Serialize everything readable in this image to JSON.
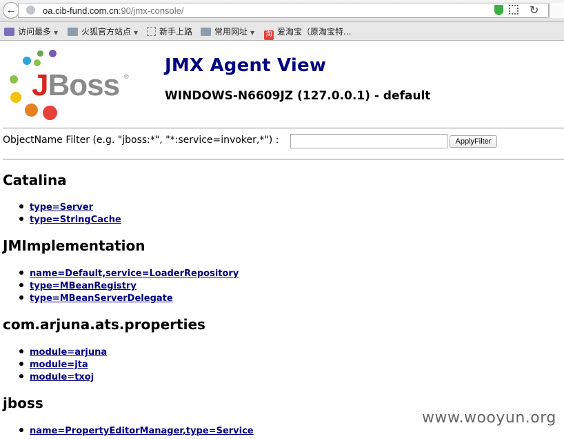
{
  "browser": {
    "url_host": "oa.cib-fund.com.cn",
    "url_rest": ":90/jmx-console/",
    "bookmarks": [
      {
        "label": "访问最多",
        "icon": "smart-folder-icon",
        "has_dropdown": true
      },
      {
        "label": "火狐官方站点",
        "icon": "folder-icon",
        "has_dropdown": true
      },
      {
        "label": "新手上路",
        "icon": "blank-page-icon",
        "has_dropdown": false
      },
      {
        "label": "常用网址",
        "icon": "folder-icon",
        "has_dropdown": true
      },
      {
        "label": "爱淘宝（原淘宝特...",
        "icon": "taobao-icon",
        "has_dropdown": false
      }
    ]
  },
  "header": {
    "logo_j": "J",
    "logo_rest": "Boss",
    "logo_reg": "®",
    "title": "JMX Agent View",
    "subtitle": "WINDOWS-N6609JZ (127.0.0.1) - default"
  },
  "filter": {
    "label": "ObjectName Filter (e.g. \"jboss:*\", \"*:service=invoker,*\") :",
    "value": "",
    "button_label": "ApplyFilter"
  },
  "domains": [
    {
      "name": "Catalina",
      "mbeans": [
        "type=Server",
        "type=StringCache"
      ]
    },
    {
      "name": "JMImplementation",
      "mbeans": [
        "name=Default,service=LoaderRepository",
        "type=MBeanRegistry",
        "type=MBeanServerDelegate"
      ]
    },
    {
      "name": "com.arjuna.ats.properties",
      "mbeans": [
        "module=arjuna",
        "module=jta",
        "module=txoj"
      ]
    },
    {
      "name": "jboss",
      "mbeans": [
        "name=PropertyEditorManager,type=Service"
      ]
    }
  ],
  "watermark": "www.wooyun.org",
  "colors": {
    "link": "#000080",
    "title": "#000080",
    "logo_red": "#d7261d"
  }
}
